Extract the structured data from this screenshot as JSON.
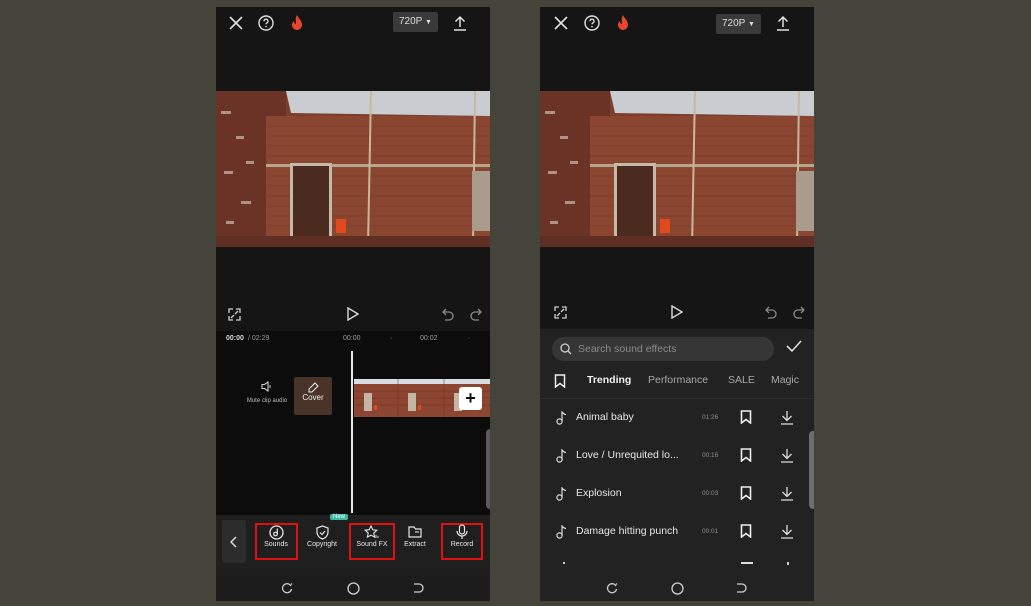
{
  "left_screen": {
    "topbar": {
      "close_icon": "close-icon",
      "help_icon": "help-icon",
      "flame_icon": "flame-icon",
      "resolution": "720P",
      "export_icon": "upload-icon"
    },
    "controls": {
      "fullscreen_icon": "fullscreen-icon",
      "play_icon": "play-icon",
      "undo_icon": "undo-icon",
      "redo_icon": "redo-icon"
    },
    "timeline": {
      "current_time": "00:00",
      "total_time": "/ 02:29",
      "ruler": [
        "00:00",
        "00:02"
      ],
      "mute_label": "Mute clip audio",
      "cover_label": "Cover",
      "add_icon": "+"
    },
    "toolbar": {
      "back_icon": "chevron-left-icon",
      "new_badge": "New",
      "tools": [
        {
          "label": "Sounds",
          "icon": "music-disc-icon",
          "highlighted": true
        },
        {
          "label": "Copyright",
          "icon": "shield-check-icon",
          "highlighted": false
        },
        {
          "label": "Sound FX",
          "icon": "star-sound-icon",
          "highlighted": true
        },
        {
          "label": "Extract",
          "icon": "folder-icon",
          "highlighted": false
        },
        {
          "label": "Record",
          "icon": "microphone-icon",
          "highlighted": true
        }
      ],
      "highlight_color": "#e01010"
    }
  },
  "right_screen": {
    "topbar": {
      "resolution": "720P"
    },
    "sound_effects": {
      "search_placeholder": "Search sound effects",
      "tabs": [
        "Trending",
        "Performance",
        "SALE",
        "Magic"
      ],
      "active_tab": "Trending",
      "items": [
        {
          "name": "Animal baby",
          "duration": "01:26"
        },
        {
          "name": "Love / Unrequited lo...",
          "duration": "00:16"
        },
        {
          "name": "Explosion",
          "duration": "00:03"
        },
        {
          "name": "Damage hitting punch",
          "duration": "00:01"
        }
      ]
    }
  },
  "colors": {
    "background": "#45443b",
    "flame": "#e8452c",
    "panel": "#222222"
  }
}
